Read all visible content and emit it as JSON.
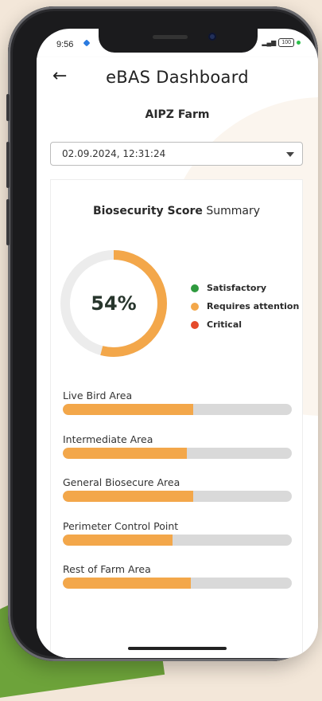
{
  "status": {
    "time": "9:56",
    "battery": "100"
  },
  "appbar": {
    "title": "eBAS Dashboard",
    "back_icon": "arrow-left-icon"
  },
  "farm": {
    "name": "AIPZ Farm"
  },
  "date_select": {
    "value": "02.09.2024, 12:31:24"
  },
  "summary": {
    "title_bold": "Biosecurity Score",
    "title_rest": " Summary",
    "score_label": "54%",
    "score": 54,
    "ring_color": "#f3a74a",
    "legend": [
      {
        "label": "Satisfactory",
        "color": "#2e9a3e"
      },
      {
        "label": "Requires attention",
        "color": "#f3a74a"
      },
      {
        "label": "Critical",
        "color": "#e54a2b"
      }
    ]
  },
  "areas": [
    {
      "label": "Live Bird Area",
      "score": 57
    },
    {
      "label": "Intermediate Area",
      "score": 54
    },
    {
      "label": "General Biosecure Area",
      "score": 57
    },
    {
      "label": "Perimeter Control Point",
      "score": 48
    },
    {
      "label": "Rest of Farm Area",
      "score": 56
    }
  ]
}
